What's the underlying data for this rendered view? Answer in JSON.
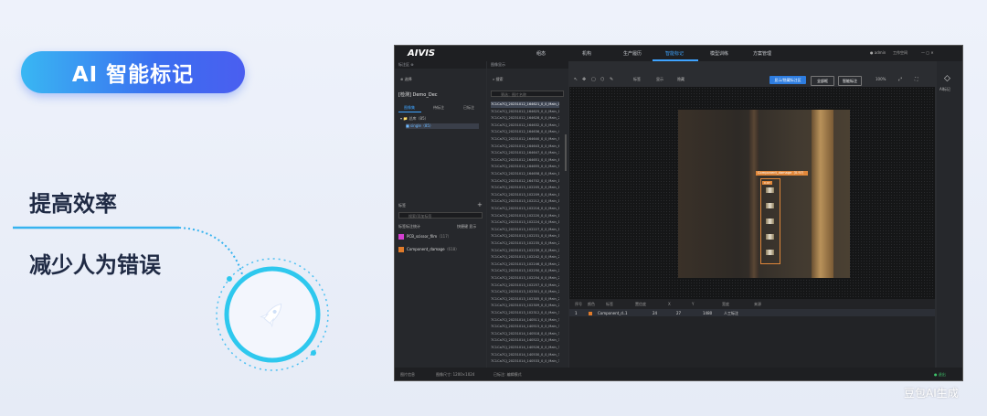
{
  "slide": {
    "pill_title": "AI 智能标记",
    "benefits": [
      "提高效率",
      "减少人为错误"
    ],
    "watermark": "豆包AI生成"
  },
  "app": {
    "logo": "AIVIS",
    "nav_tabs": [
      "组态",
      "机构",
      "生产履历",
      "智能标记",
      "模型训练",
      "方案管理"
    ],
    "active_tab_index": 3,
    "user": "admin",
    "workspace": "工作空间",
    "left_panel": {
      "header": "标注区 ⊕",
      "file_btn": "选择",
      "project": "[检测] Demo_Dec",
      "subtabs": [
        "图像集",
        "待标注",
        "已标注"
      ],
      "tree": [
        {
          "label": "▾ 📁 总库（85）",
          "selected": false
        },
        {
          "label": "■ single（85）",
          "selected": true
        }
      ],
      "labels_header": "标签",
      "label_search": "搜索/添加标签",
      "label_counts_header": "标签标注统计",
      "label_hint": "快捷键  显示",
      "labels": [
        {
          "name": "PCB_scissor_film",
          "count": "（117）",
          "color": "#d43fd1"
        },
        {
          "name": "Component_damage",
          "count": "（618）",
          "color": "#e07b2a"
        }
      ]
    },
    "file_panel": {
      "header": "图像显示",
      "search": "搜索",
      "filter": "筛选：图片名称",
      "files": [
        "7C1Ca7CJ_20231012_164621_0_0_Main_0_0",
        "7C1Ca7CJ_20231012_164625_0_0_Main_1_0",
        "7C1Ca7CJ_20231012_164628_0_0_Main_2_0",
        "7C1Ca7CJ_20231012_164632_0_0_Main_3_0",
        "7C1Ca7CJ_20231012_164636_0_0_Main_4_0",
        "7C1Ca7CJ_20231012_164640_0_0_Main_5_0",
        "7C1Ca7CJ_20231012_164643_0_0_Main_6_0",
        "7C1Ca7CJ_20231012_164647_0_0_Main_7_0",
        "7C1Ca7CJ_20231012_164651_0_0_Main_8_0",
        "7C1Ca7CJ_20231012_164655_0_0_Main_9_0",
        "7C1Ca7CJ_20231012_164658_0_0_Main_10_0",
        "7C1Ca7CJ_20231012_164702_0_0_Main_11_0",
        "7C1Ca7CJ_20231013_102205_0_0_Main_12_0",
        "7C1Ca7CJ_20231013_102209_0_0_Main_13_0",
        "7C1Ca7CJ_20231013_102212_0_0_Main_14_0",
        "7C1Ca7CJ_20231013_102216_0_0_Main_15_0",
        "7C1Ca7CJ_20231013_102220_0_0_Main_16_0",
        "7C1Ca7CJ_20231013_102224_0_0_Main_17_0",
        "7C1Ca7CJ_20231013_102227_0_0_Main_18_0",
        "7C1Ca7CJ_20231013_102231_0_0_Main_19_0",
        "7C1Ca7CJ_20231013_102235_0_0_Main_20_0",
        "7C1Ca7CJ_20231013_102239_0_0_Main_21_0",
        "7C1Ca7CJ_20231013_102242_0_0_Main_22_0",
        "7C1Ca7CJ_20231013_102246_0_0_Main_23_0",
        "7C1Ca7CJ_20231013_102250_0_0_Main_24_0",
        "7C1Ca7CJ_20231013_102254_0_0_Main_25_0",
        "7C1Ca7CJ_20231013_102257_0_0_Main_26_0",
        "7C1Ca7CJ_20231013_102301_0_0_Main_27_0",
        "7C1Ca7CJ_20231013_102305_0_0_Main_28_0",
        "7C1Ca7CJ_20231013_102309_0_0_Main_29_0",
        "7C1Ca7CJ_20231013_102312_0_0_Main_30_0",
        "7C1Ca7CJ_20231014_140511_0_0_Main_31_0",
        "7C1Ca7CJ_20231014_140515_0_0_Main_32_0",
        "7C1Ca7CJ_20231014_140518_0_0_Main_33_0",
        "7C1Ca7CJ_20231014_140522_0_0_Main_34_0",
        "7C1Ca7CJ_20231014_140526_0_0_Main_35_0",
        "7C1Ca7CJ_20231014_140530_0_0_Main_36_0",
        "7C1Ca7CJ_20231014_140533_0_0_Main_37_0"
      ],
      "selected_index": 0
    },
    "toolbar": {
      "tools": [
        "↖",
        "✥",
        "▢",
        "⬡",
        "✎"
      ],
      "labels": [
        "标签",
        "显示",
        "隐藏"
      ],
      "auto_btn": "显示/隐藏标注区",
      "btn2": "全部框",
      "btn3": "智能标注",
      "zoom": "100%"
    },
    "annotation": {
      "label": "Component_damage（0.97）",
      "small_label": "0.97"
    },
    "table": {
      "headers": [
        "序号",
        "颜色",
        "标签",
        "置信度",
        "X",
        "Y",
        "宽度",
        "来源"
      ],
      "row": [
        "1",
        "",
        "Component_d...",
        "1",
        "24",
        "27",
        "1480",
        "人工标注"
      ]
    },
    "right_panel": {
      "label": "AI标记"
    },
    "status": {
      "left": "图片信息",
      "middle": "图像尺寸: 1200×1024",
      "source": "已标注: 编辑模式",
      "right": "● 退出"
    }
  }
}
